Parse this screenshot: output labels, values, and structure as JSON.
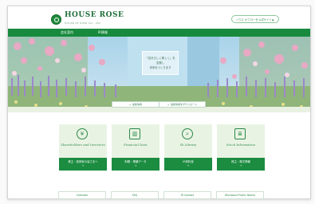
{
  "header": {
    "logo_text": "HOUSE ROSE",
    "logo_sub": "HOUSE OF ROSE CO., LTD.",
    "top_link": "ハウス オブ ローゼ 公式サイト ▶"
  },
  "nav": {
    "items": [
      "会社案内",
      "IR情報"
    ]
  },
  "hero": {
    "message_lines": [
      "「自分らしく美しく」を",
      "支援し",
      "未来をつくります"
    ],
    "search": [
      {
        "icon": "arrow-icon",
        "label": "最新情報"
      },
      {
        "icon": "arrow-icon",
        "label": "最新情報をダウンロード"
      }
    ]
  },
  "cards": [
    {
      "icon": "yen-icon",
      "title": "Shareholders and Investors",
      "button": "株主・投資家の皆さまへ"
    },
    {
      "icon": "chart-icon",
      "title": "Financial Data",
      "button": "財務・業績データ"
    },
    {
      "icon": "search-icon",
      "title": "IR Library",
      "button": "IR資料室"
    },
    {
      "icon": "document-icon",
      "title": "Stock Information",
      "button": "株主・株式情報"
    }
  ],
  "bottom_links": [
    "Calendar",
    "FAQ",
    "IR Contact",
    "Disclosure Public Notice"
  ],
  "colors": {
    "brand_green": "#178a3e",
    "card_bg": "#e9f3e3"
  }
}
